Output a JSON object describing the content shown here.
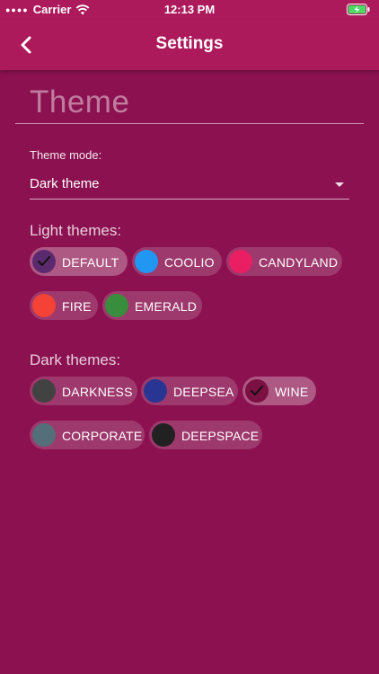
{
  "status_bar": {
    "carrier": "Carrier",
    "time": "12:13 PM",
    "wifi_icon": "wifi-icon",
    "battery_icon": "battery-charging-icon"
  },
  "app_bar": {
    "title": "Settings",
    "back_icon": "chevron-left-icon"
  },
  "theme": {
    "heading": "Theme",
    "mode_label": "Theme mode:",
    "mode_value": "Dark theme"
  },
  "light_themes": {
    "label": "Light themes:",
    "items": [
      {
        "name": "DEFAULT",
        "color": "#5b2a6e",
        "selected": true
      },
      {
        "name": "COOLIO",
        "color": "#2196f3",
        "selected": false
      },
      {
        "name": "CANDYLAND",
        "color": "#e91e63",
        "selected": false
      },
      {
        "name": "FIRE",
        "color": "#f44336",
        "selected": false
      },
      {
        "name": "EMERALD",
        "color": "#388e3c",
        "selected": false
      }
    ]
  },
  "dark_themes": {
    "label": "Dark themes:",
    "items": [
      {
        "name": "DARKNESS",
        "color": "#424242",
        "selected": false
      },
      {
        "name": "DEEPSEA",
        "color": "#283593",
        "selected": false
      },
      {
        "name": "WINE",
        "color": "#7b1042",
        "selected": true
      },
      {
        "name": "CORPORATE",
        "color": "#546e7a",
        "selected": false
      },
      {
        "name": "DEEPSPACE",
        "color": "#212121",
        "selected": false
      }
    ]
  },
  "colors": {
    "background": "#8b1150",
    "app_bar": "#ac1a5b"
  }
}
